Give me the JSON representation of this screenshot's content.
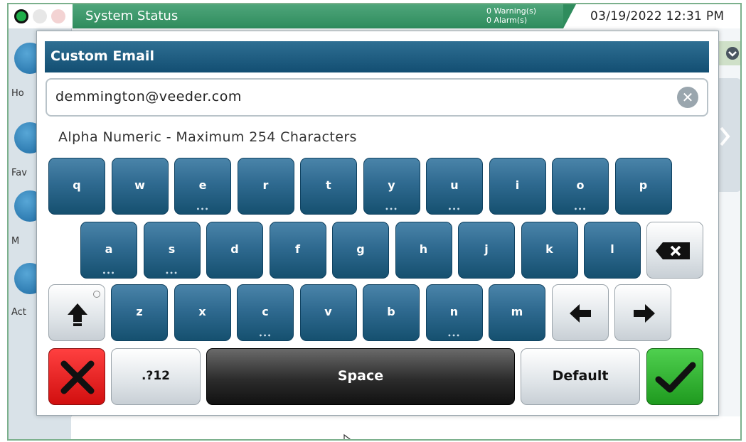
{
  "header": {
    "title": "System Status",
    "warnings": "0 Warning(s)",
    "alarms": "0 Alarm(s)",
    "datetime": "03/19/2022 12:31 PM"
  },
  "sidebar": {
    "items": [
      {
        "label": "Ho"
      },
      {
        "label": "Fav"
      },
      {
        "label": "M"
      },
      {
        "label": "Act"
      }
    ]
  },
  "dialog": {
    "title": "Custom Email",
    "value": "demmington@veeder.com",
    "hint": "Alpha Numeric - Maximum 254 Characters"
  },
  "keyboard": {
    "row1": [
      {
        "label": "q",
        "more": false
      },
      {
        "label": "w",
        "more": false
      },
      {
        "label": "e",
        "more": true
      },
      {
        "label": "r",
        "more": false
      },
      {
        "label": "t",
        "more": false
      },
      {
        "label": "y",
        "more": true
      },
      {
        "label": "u",
        "more": true
      },
      {
        "label": "i",
        "more": false
      },
      {
        "label": "o",
        "more": true
      },
      {
        "label": "p",
        "more": false
      }
    ],
    "row2": [
      {
        "label": "a",
        "more": true
      },
      {
        "label": "s",
        "more": true
      },
      {
        "label": "d",
        "more": false
      },
      {
        "label": "f",
        "more": false
      },
      {
        "label": "g",
        "more": false
      },
      {
        "label": "h",
        "more": false
      },
      {
        "label": "j",
        "more": false
      },
      {
        "label": "k",
        "more": false
      },
      {
        "label": "l",
        "more": false
      }
    ],
    "row3": [
      {
        "label": "z",
        "more": false
      },
      {
        "label": "x",
        "more": false
      },
      {
        "label": "c",
        "more": true
      },
      {
        "label": "v",
        "more": false
      },
      {
        "label": "b",
        "more": false
      },
      {
        "label": "n",
        "more": true
      },
      {
        "label": "m",
        "more": false
      }
    ],
    "symbols_label": ".?12",
    "space_label": "Space",
    "default_label": "Default",
    "more_indicator": "•••"
  },
  "colors": {
    "header_green": "#2f8c5d",
    "key_blue": "#2f6a90",
    "cancel_red": "#e02020",
    "ok_green": "#2aa82a",
    "dialog_title": "#1b5a80"
  },
  "icons": {
    "backspace": "backspace-icon",
    "shift": "shift-up-arrow-icon",
    "left": "arrow-left-icon",
    "right": "arrow-right-icon",
    "cancel": "x-icon",
    "ok": "checkmark-icon",
    "clear": "clear-circle-x-icon"
  }
}
